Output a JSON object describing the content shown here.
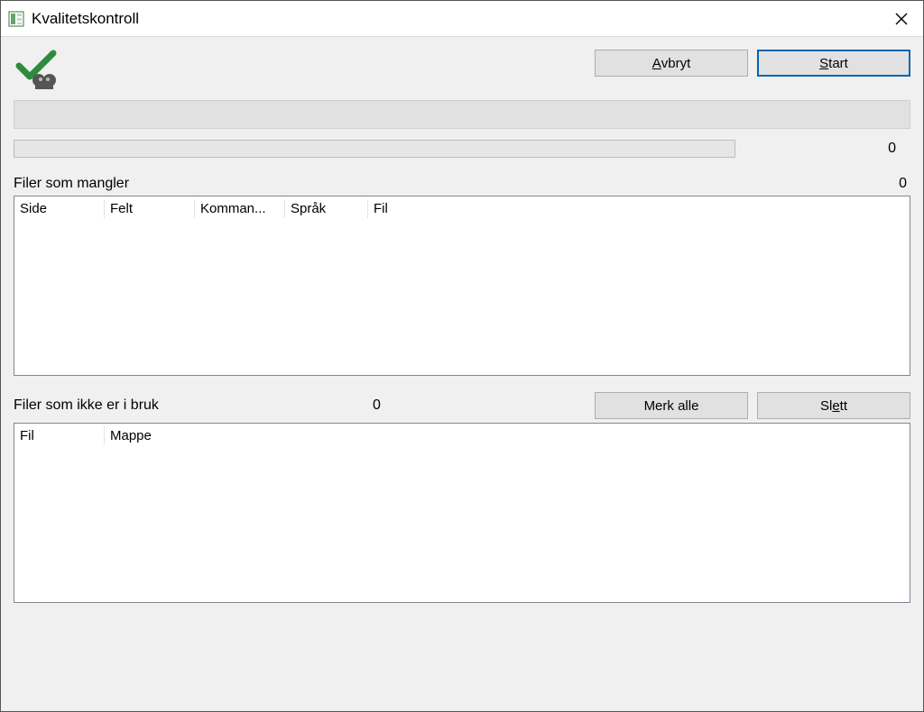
{
  "window": {
    "title": "Kvalitetskontroll"
  },
  "actions": {
    "cancel_prefix": "",
    "cancel_accel": "A",
    "cancel_rest": "vbryt",
    "start_prefix": "",
    "start_accel": "S",
    "start_rest": "tart",
    "mark_all": "Merk alle",
    "delete_prefix": "Sl",
    "delete_accel": "e",
    "delete_rest": "tt"
  },
  "progress": {
    "value": "0"
  },
  "missing": {
    "label": "Filer som mangler",
    "count": "0",
    "columns": [
      "Side",
      "Felt",
      "Komman...",
      "Språk",
      "Fil"
    ]
  },
  "unused": {
    "label": "Filer som ikke er i bruk",
    "count": "0",
    "columns": [
      "Fil",
      "Mappe"
    ]
  }
}
